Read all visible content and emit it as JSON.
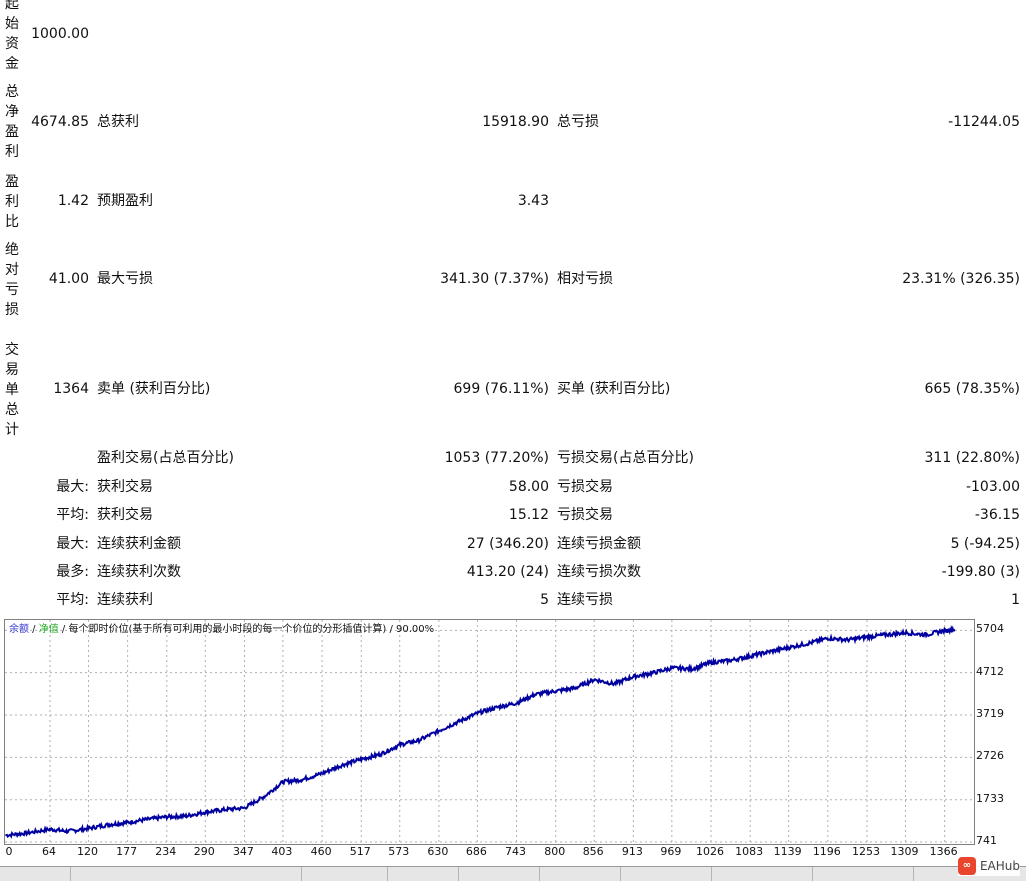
{
  "stats": {
    "labels": {
      "initial_deposit": "起始资金",
      "total_net_profit": "总净盈利",
      "profit_factor": "盈利比",
      "absolute_drawdown": "绝对亏损",
      "total_trades": "交易单总计"
    },
    "initial_deposit": "1000.00",
    "total_net_profit": "4674.85",
    "gross_profit_label": "总获利",
    "gross_profit": "15918.90",
    "gross_loss_label": "总亏损",
    "gross_loss": "-11244.05",
    "profit_factor": "1.42",
    "expected_payoff_label": "预期盈利",
    "expected_payoff": "3.43",
    "absolute_drawdown": "41.00",
    "max_drawdown_label": "最大亏损",
    "max_drawdown": "341.30 (7.37%)",
    "relative_drawdown_label": "相对亏损",
    "relative_drawdown": "23.31% (326.35)",
    "total_trades": "1364",
    "short_label": "卖单 (获利百分比)",
    "short_value": "699 (76.11%)",
    "long_label": "买单 (获利百分比)",
    "long_value": "665 (78.35%)",
    "profit_trades_label": "盈利交易(占总百分比)",
    "profit_trades": "1053 (77.20%)",
    "loss_trades_label": "亏损交易(占总百分比)",
    "loss_trades": "311 (22.80%)",
    "largest_prefix": "最大:",
    "largest_profit_label": "获利交易",
    "largest_profit": "58.00",
    "largest_loss_label": "亏损交易",
    "largest_loss": "-103.00",
    "average_prefix": "平均:",
    "average_profit_label": "获利交易",
    "average_profit": "15.12",
    "average_loss_label": "亏损交易",
    "average_loss": "-36.15",
    "max_consec_prefix": "最大:",
    "max_consec_wins_label": "连续获利金额",
    "max_consec_wins": "27 (346.20)",
    "max_consec_losses_label": "连续亏损金额",
    "max_consec_losses": "5 (-94.25)",
    "maximal_prefix": "最多:",
    "maximal_consec_profit_label": "连续获利次数",
    "maximal_consec_profit": "413.20 (24)",
    "maximal_consec_loss_label": "连续亏损次数",
    "maximal_consec_loss": "-199.80 (3)",
    "avg_consec_prefix": "平均:",
    "avg_consec_wins_label": "连续获利",
    "avg_consec_wins": "5",
    "avg_consec_losses_label": "连续亏损",
    "avg_consec_losses": "1"
  },
  "chart": {
    "legend_balance": "余额",
    "legend_sep1": " / ",
    "legend_equity": "净值",
    "legend_rest": " / 每个即时价位(基于所有可利用的最小时段的每一个价位的分形插值计算) / 90.00%",
    "y_ticks": [
      "5704",
      "4712",
      "3719",
      "2726",
      "1733",
      "741"
    ],
    "x_ticks": [
      "0",
      "64",
      "120",
      "177",
      "234",
      "290",
      "347",
      "403",
      "460",
      "517",
      "573",
      "630",
      "686",
      "743",
      "800",
      "856",
      "913",
      "969",
      "1026",
      "1083",
      "1139",
      "1196",
      "1253",
      "1309",
      "1366"
    ],
    "colors": {
      "line": "#0000a0",
      "balance_legend": "#3a3ad8",
      "equity_legend": "#22aa22",
      "grid": "#b0b0b0"
    }
  },
  "chart_data": {
    "type": "line",
    "x": [
      0,
      30,
      64,
      90,
      120,
      150,
      177,
      205,
      234,
      262,
      290,
      318,
      347,
      375,
      403,
      430,
      460,
      490,
      517,
      545,
      573,
      600,
      630,
      658,
      686,
      715,
      743,
      770,
      800,
      828,
      856,
      885,
      913,
      940,
      969,
      998,
      1026,
      1055,
      1083,
      1110,
      1139,
      1168,
      1196,
      1225,
      1253,
      1280,
      1309,
      1338,
      1366,
      1380
    ],
    "series": [
      {
        "values": [
          900,
          950,
          1040,
          990,
          1060,
          1150,
          1200,
          1270,
          1330,
          1350,
          1440,
          1500,
          1540,
          1800,
          2150,
          2200,
          2350,
          2550,
          2680,
          2800,
          3020,
          3120,
          3350,
          3560,
          3760,
          3900,
          4000,
          4200,
          4280,
          4350,
          4550,
          4450,
          4620,
          4700,
          4820,
          4800,
          4950,
          5000,
          5100,
          5200,
          5300,
          5400,
          5520,
          5480,
          5550,
          5600,
          5650,
          5600,
          5700,
          5720
        ]
      }
    ],
    "ylim": [
      741,
      5900
    ],
    "xlim": [
      0,
      1400
    ],
    "grid": true
  },
  "watermark": {
    "text": "EAHub",
    "logo": "∞"
  }
}
